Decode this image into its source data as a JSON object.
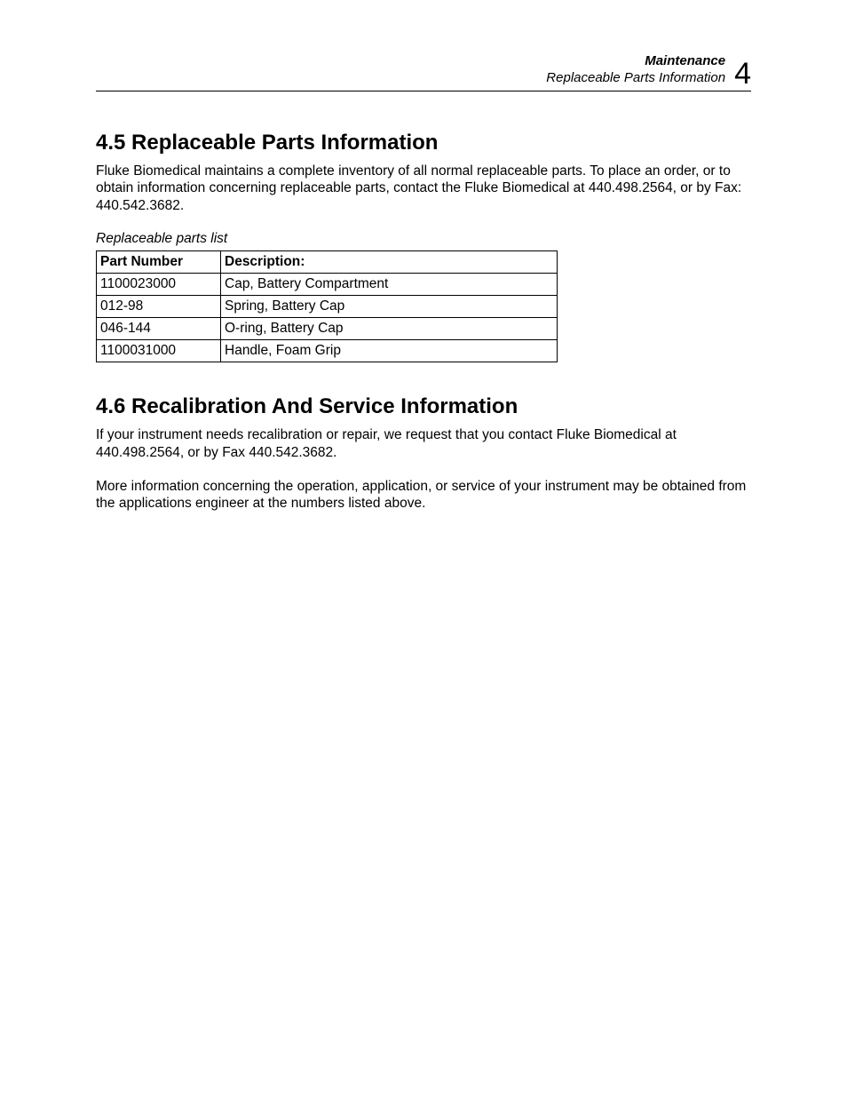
{
  "header": {
    "line1": "Maintenance",
    "line2": "Replaceable Parts Information",
    "chapter_number": "4"
  },
  "section45": {
    "heading": "4.5  Replaceable Parts Information",
    "paragraph": "Fluke Biomedical maintains a complete inventory of all normal replaceable parts.  To place an order, or to obtain information concerning replaceable parts, contact the Fluke Biomedical at 440.498.2564, or by Fax: 440.542.3682."
  },
  "parts_table": {
    "caption": "Replaceable parts list",
    "headers": {
      "part_number": "Part Number",
      "description": "Description:"
    },
    "rows": [
      {
        "part_number": "1100023000",
        "description": "Cap, Battery Compartment"
      },
      {
        "part_number": "012-98",
        "description": "Spring, Battery Cap"
      },
      {
        "part_number": "046-144",
        "description": "O-ring, Battery Cap"
      },
      {
        "part_number": "1100031000",
        "description": "Handle, Foam Grip"
      }
    ]
  },
  "section46": {
    "heading": "4.6 Recalibration And Service Information",
    "paragraph1": "If your instrument needs recalibration or repair, we request that you contact Fluke Biomedical at 440.498.2564, or by Fax 440.542.3682.",
    "paragraph2": "More information concerning the operation, application, or service of your instrument may be obtained from the applications engineer at the numbers listed above."
  }
}
